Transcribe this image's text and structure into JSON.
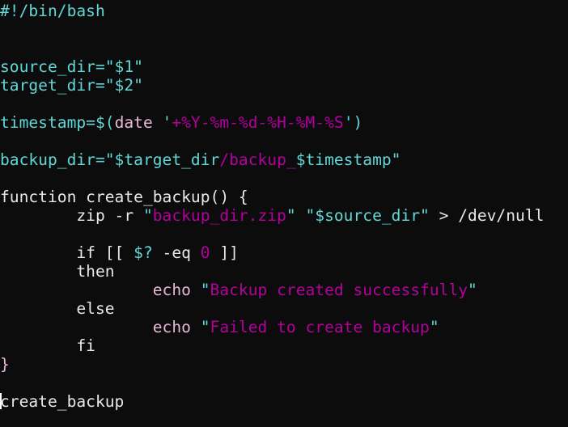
{
  "editor": {
    "lines": [
      [
        {
          "t": "#!/bin/bash",
          "c": "cyan"
        }
      ],
      [],
      [],
      [
        {
          "t": "source_dir=\"$1\"",
          "c": "cyan"
        }
      ],
      [
        {
          "t": "target_dir=\"$2\"",
          "c": "cyan"
        }
      ],
      [],
      [
        {
          "t": "timestamp=$(",
          "c": "cyan"
        },
        {
          "t": "date ",
          "c": "pink"
        },
        {
          "t": "'",
          "c": "cyan"
        },
        {
          "t": "+%Y-%m-%d-%H-%M-%S",
          "c": "magenta"
        },
        {
          "t": "')",
          "c": "cyan"
        }
      ],
      [],
      [
        {
          "t": "backup_dir=\"$target_dir",
          "c": "cyan"
        },
        {
          "t": "/backup_",
          "c": "magenta"
        },
        {
          "t": "$timestamp\"",
          "c": "cyan"
        }
      ],
      [],
      [
        {
          "t": "function create_backup() {",
          "c": "white"
        }
      ],
      [
        {
          "t": "        zip -r ",
          "c": "white"
        },
        {
          "t": "\"",
          "c": "cyan"
        },
        {
          "t": "backup_dir.zip",
          "c": "magenta"
        },
        {
          "t": "\" \"",
          "c": "cyan"
        },
        {
          "t": "$source_dir\"",
          "c": "cyan"
        },
        {
          "t": " > /dev/null",
          "c": "white"
        }
      ],
      [],
      [
        {
          "t": "        if [[ ",
          "c": "white"
        },
        {
          "t": "$?",
          "c": "cyan"
        },
        {
          "t": " -eq ",
          "c": "white"
        },
        {
          "t": "0",
          "c": "magenta"
        },
        {
          "t": " ]]",
          "c": "white"
        }
      ],
      [
        {
          "t": "        then",
          "c": "white"
        }
      ],
      [
        {
          "t": "                echo ",
          "c": "pink"
        },
        {
          "t": "\"",
          "c": "cyan"
        },
        {
          "t": "Backup created successfully",
          "c": "magenta"
        },
        {
          "t": "\"",
          "c": "cyan"
        }
      ],
      [
        {
          "t": "        else",
          "c": "white"
        }
      ],
      [
        {
          "t": "                echo ",
          "c": "pink"
        },
        {
          "t": "\"",
          "c": "cyan"
        },
        {
          "t": "Failed to create backup",
          "c": "magenta"
        },
        {
          "t": "\"",
          "c": "cyan"
        }
      ],
      [
        {
          "t": "        fi",
          "c": "white"
        }
      ],
      [
        {
          "t": "}",
          "c": "pink"
        }
      ],
      [],
      [
        {
          "t": "create_backup",
          "c": "white",
          "cursor": true
        }
      ]
    ]
  },
  "colors": {
    "background": "#0c0c0c",
    "cyan": "#61d6d6",
    "magenta": "#b4009e",
    "white": "#e8e8e8",
    "pink": "#e8b8d8"
  }
}
